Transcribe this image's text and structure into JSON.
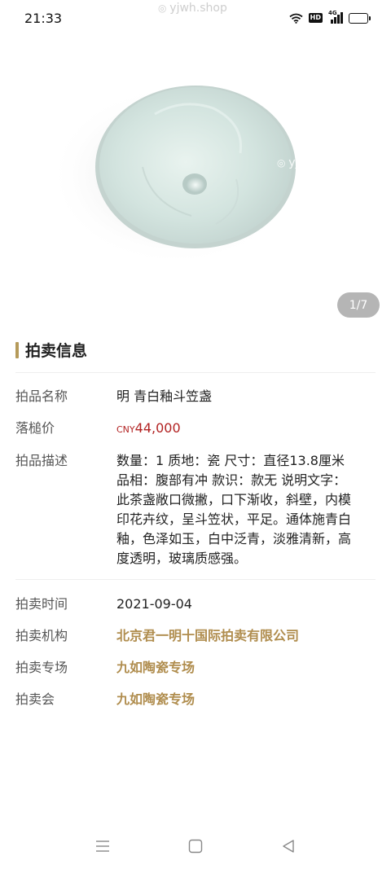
{
  "status_bar": {
    "time": "21:33",
    "icons": [
      "wifi-icon",
      "hd-icon",
      "signal-4g-icon",
      "battery-icon"
    ],
    "hd_label": "HD",
    "network_label": "4G"
  },
  "gallery": {
    "watermark": "yjwh.shop",
    "page_indicator": "1/7",
    "image": "celadon-bowl-photo"
  },
  "auction_info": {
    "section_title": "拍卖信息",
    "accent_color": "#b59a5a",
    "rows": [
      {
        "label": "拍品名称",
        "value": "明 青白釉斗笠盏"
      },
      {
        "label": "落槌价",
        "currency": "CNY",
        "amount": "44,000"
      },
      {
        "label": "拍品描述",
        "value": "数量：1 质地：瓷 尺寸：直径13.8厘米\n品相：腹部有冲 款识：款无 说明文字：\n此茶盏敞口微撇，口下渐收，斜壁，内模\n印花卉纹，呈斗笠状，平足。通体施青白\n釉，色泽如玉，白中泛青，淡雅清新，高\n度透明，玻璃质感强。"
      },
      {
        "label": "拍卖时间",
        "value": "2021-09-04"
      },
      {
        "label": "拍卖机构",
        "value": "北京君一明十国际拍卖有限公司"
      },
      {
        "label": "拍卖专场",
        "value": "九如陶瓷专场"
      },
      {
        "label": "拍卖会",
        "value": "九如陶瓷专场"
      }
    ]
  },
  "nav_bar": {
    "buttons": [
      "menu-icon",
      "home-icon",
      "back-icon"
    ]
  }
}
